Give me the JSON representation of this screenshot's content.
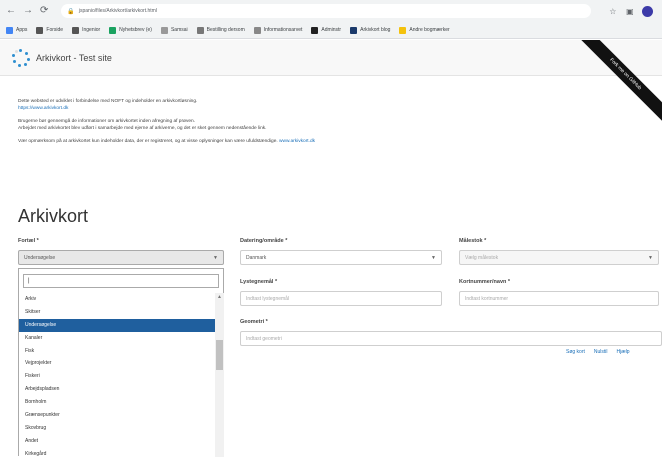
{
  "browser": {
    "url": "jspanio/files/Arkivkort/arkivkort.html",
    "bookmarks": [
      "Apps",
      "Forside",
      "Ingenior",
      "Nyhetsbrev (e)",
      "Samsai",
      "Bestilling dersom",
      "Informationsarvet",
      "Adminstr",
      "Arkivkort blog",
      "Andre bogmærker"
    ]
  },
  "header": {
    "site_title": "Arkivkort - Test site",
    "ribbon": "Fork me on GitHub"
  },
  "intro": {
    "p1": "Dette websted er udviklet i forbindelse med NOFT og indeholder en arkivkortløsning.",
    "p1_link": "https://www.arkivkort.dk",
    "p2": "Brugerne bør gennemgå de informationer om arkivkortet inden afregning af prøven.",
    "p3": "Arbejdet med arkivkortet blev udført i samarbejde med ejerne af arkiverne, og det er sket gennem nedenstående link.",
    "p4": "Vær opmærksom på at arkivkortet kun indeholder data, der er registreret, og at visse oplysninger kan være ufuldstændige.",
    "p4_link": "www.arkivkort.dk"
  },
  "page_title": "Arkivkort",
  "form": {
    "field1_label": "Fortæl *",
    "field1_value": "Undersøgelse",
    "field2_label": "Datering/område *",
    "field2_value": "Danmark",
    "field3_label": "Målestok *",
    "field3_value": "Vælg målestok",
    "field4_label": "Lystegnemål *",
    "field4_placeholder": "Indtast lystegnemål",
    "field5_label": "Kortnummer/navn *",
    "field5_placeholder": "Indtast kortnummer",
    "field6_label": "Geometri *",
    "field6_placeholder": "Indtast geometri",
    "link_search": "Søg kort",
    "link_reset": "Nulstil",
    "link_help": "Hjælp"
  },
  "dropdown": {
    "items": [
      "Arkiv",
      "Skitser",
      "Undersøgelse",
      "Kanaler",
      "Fisk",
      "Vejprojekter",
      "Fiskeri",
      "Arbejdspladsen",
      "Bornholm",
      "Grænsepunkter",
      "Skovbrug",
      "Andet",
      "Kirkegård"
    ],
    "selected_index": 2
  }
}
